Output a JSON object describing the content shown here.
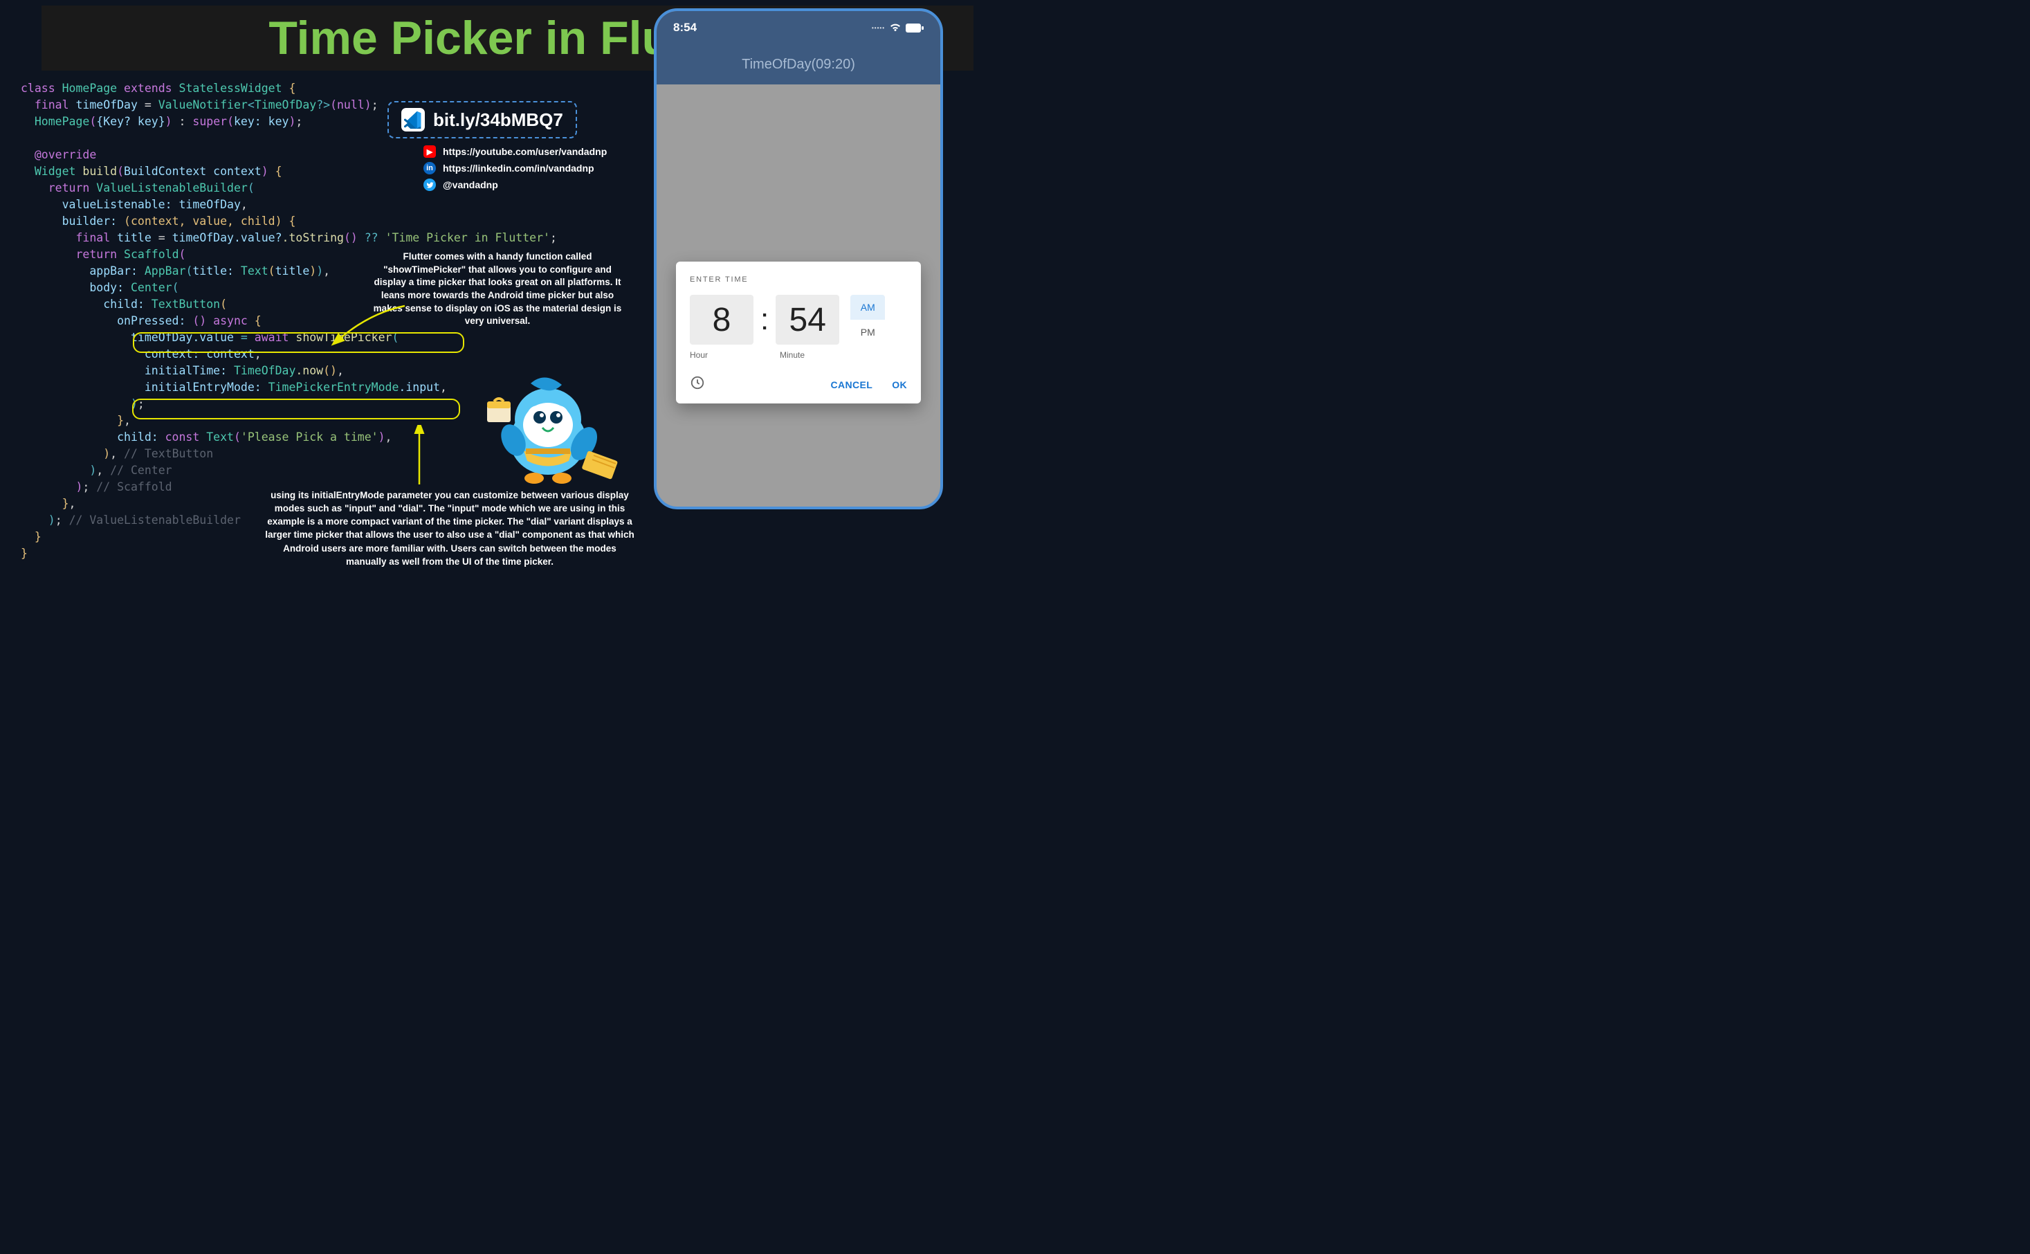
{
  "title": "Time Picker in Flutter",
  "link_badge": "bit.ly/34bMBQ7",
  "socials": {
    "youtube": "https://youtube.com/user/vandadnp",
    "linkedin": "https://linkedin.com/in/vandadnp",
    "twitter": "@vandadnp"
  },
  "callout_top": "Flutter comes with a handy function called \"showTimePicker\" that allows you to configure and display a time picker that looks great on all platforms. It leans more towards the Android time picker but also makes sense to display on iOS as the material design is very universal.",
  "callout_bottom": "using its initialEntryMode parameter you can customize between various display modes such as \"input\" and \"dial\". The \"input\" mode which we are using in this example is a more compact variant of the time picker. The \"dial\" variant displays a larger time picker that allows the user to also use a \"dial\" component as that which Android users are more familiar with. Users can switch between the modes manually as well from the UI of the time picker.",
  "code": {
    "class_kw": "class",
    "class_name": "HomePage",
    "extends_kw": "extends",
    "super_type": "StatelessWidget",
    "final_kw": "final",
    "field": "timeOfDay",
    "eq": " = ",
    "vn": "ValueNotifier",
    "tod": "TimeOfDay",
    "qn": "?>",
    "null": "null",
    "ctor": "HomePage",
    "keyparam": "{Key? key}",
    "superc": "super",
    "keyarg": "key: key",
    "override": "@override",
    "widget": "Widget",
    "build": "build",
    "ctx": "BuildContext context",
    "return": "return",
    "vlb": "ValueListenableBuilder",
    "vl_label": "valueListenable:",
    "vl_val": "timeOfDay",
    "builder_label": "builder:",
    "builder_sig": "(context, value, child)",
    "title_var": "title",
    "tostr": ".toString",
    "fallback": "'Time Picker in Flutter'",
    "scaffold": "Scaffold",
    "appbar_label": "appBar:",
    "appbar": "AppBar",
    "title_label": "title:",
    "text": "Text",
    "title_arg": "title",
    "body_label": "body:",
    "center": "Center",
    "child_label": "child:",
    "textbutton": "TextButton",
    "onpressed_label": "onPressed:",
    "async": "() async",
    "await": "await",
    "showtp": "showTimePicker",
    "ctx_label": "context:",
    "ctx_val": "context",
    "init_label": "initialTime:",
    "now": ".now",
    "mode_label": "initialEntryMode:",
    "mode_type": "TimePickerEntryMode",
    "mode_val": ".input",
    "const": "const",
    "btn_text": "'Please Pick a time'",
    "c_tb": "// TextButton",
    "c_center": "// Center",
    "c_scaffold": "// Scaffold",
    "c_vlb": "// ValueListenableBuilder"
  },
  "phone": {
    "status_time": "8:54",
    "appbar_title": "TimeOfDay(09:20)",
    "picker_title": "ENTER TIME",
    "hour": "8",
    "minute": "54",
    "am": "AM",
    "pm": "PM",
    "hour_label": "Hour",
    "minute_label": "Minute",
    "cancel": "CANCEL",
    "ok": "OK"
  }
}
